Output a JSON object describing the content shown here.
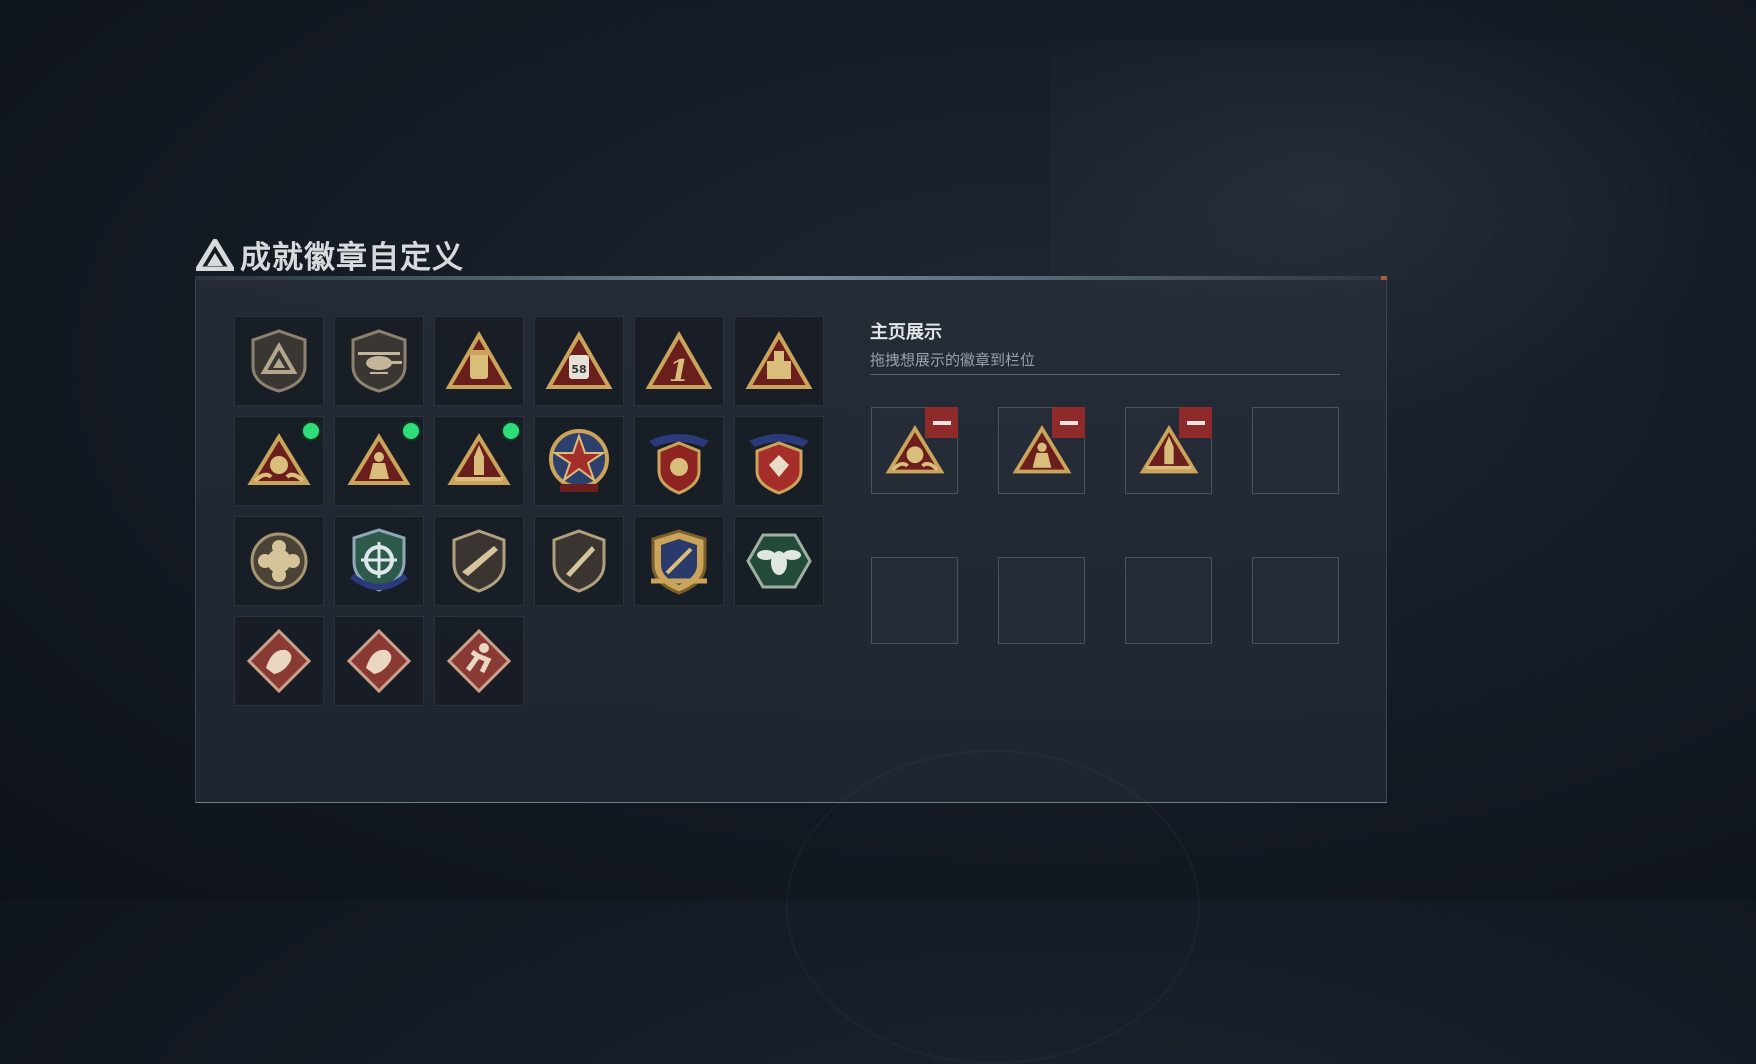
{
  "header": {
    "title": "成就徽章自定义",
    "icon": "triangle-logo-icon"
  },
  "badges": {
    "items": [
      {
        "icon": "shield-triangle-badge-icon",
        "new": false
      },
      {
        "icon": "helicopter-shield-badge-icon",
        "new": false
      },
      {
        "icon": "jar-triangle-badge-icon",
        "new": false
      },
      {
        "icon": "number-58-triangle-badge-icon",
        "new": false
      },
      {
        "icon": "number-1-triangle-badge-icon",
        "new": false
      },
      {
        "icon": "bottle-triangle-badge-icon",
        "new": false
      },
      {
        "icon": "hands-triangle-badge-icon",
        "new": true
      },
      {
        "icon": "soldier-triangle-badge-icon",
        "new": true
      },
      {
        "icon": "rocket-triangle-badge-icon",
        "new": true
      },
      {
        "icon": "star-emblem-badge-icon",
        "new": false
      },
      {
        "icon": "winged-shield-badge-icon",
        "new": false
      },
      {
        "icon": "ribbon-shield-badge-icon",
        "new": false
      },
      {
        "icon": "flower-round-badge-icon",
        "new": false
      },
      {
        "icon": "crosshair-shield-badge-icon",
        "new": false
      },
      {
        "icon": "rifle-shield-badge-icon",
        "new": false
      },
      {
        "icon": "knife-shield-badge-icon",
        "new": false
      },
      {
        "icon": "gold-crest-badge-icon",
        "new": false
      },
      {
        "icon": "wasp-hexagon-badge-icon",
        "new": false
      },
      {
        "icon": "dragon-diamond-badge-icon",
        "new": false
      },
      {
        "icon": "dragon-diamond-badge-icon",
        "new": false
      },
      {
        "icon": "runner-diamond-badge-icon",
        "new": false
      }
    ]
  },
  "display": {
    "title": "主页展示",
    "subtitle": "拖拽想展示的徽章到栏位",
    "slots": [
      {
        "badge": "hands-triangle-badge-icon",
        "filled": true
      },
      {
        "badge": "soldier-triangle-badge-icon",
        "filled": true
      },
      {
        "badge": "rocket-triangle-badge-icon",
        "filled": true
      },
      {
        "badge": "",
        "filled": false
      },
      {
        "badge": "",
        "filled": false
      },
      {
        "badge": "",
        "filled": false
      },
      {
        "badge": "",
        "filled": false
      },
      {
        "badge": "",
        "filled": false
      }
    ]
  },
  "colors": {
    "gold": "#c9a45a",
    "dark_red": "#6b1f1d",
    "new_dot": "#2fdc7a",
    "remove_button": "#8e2a2a"
  }
}
